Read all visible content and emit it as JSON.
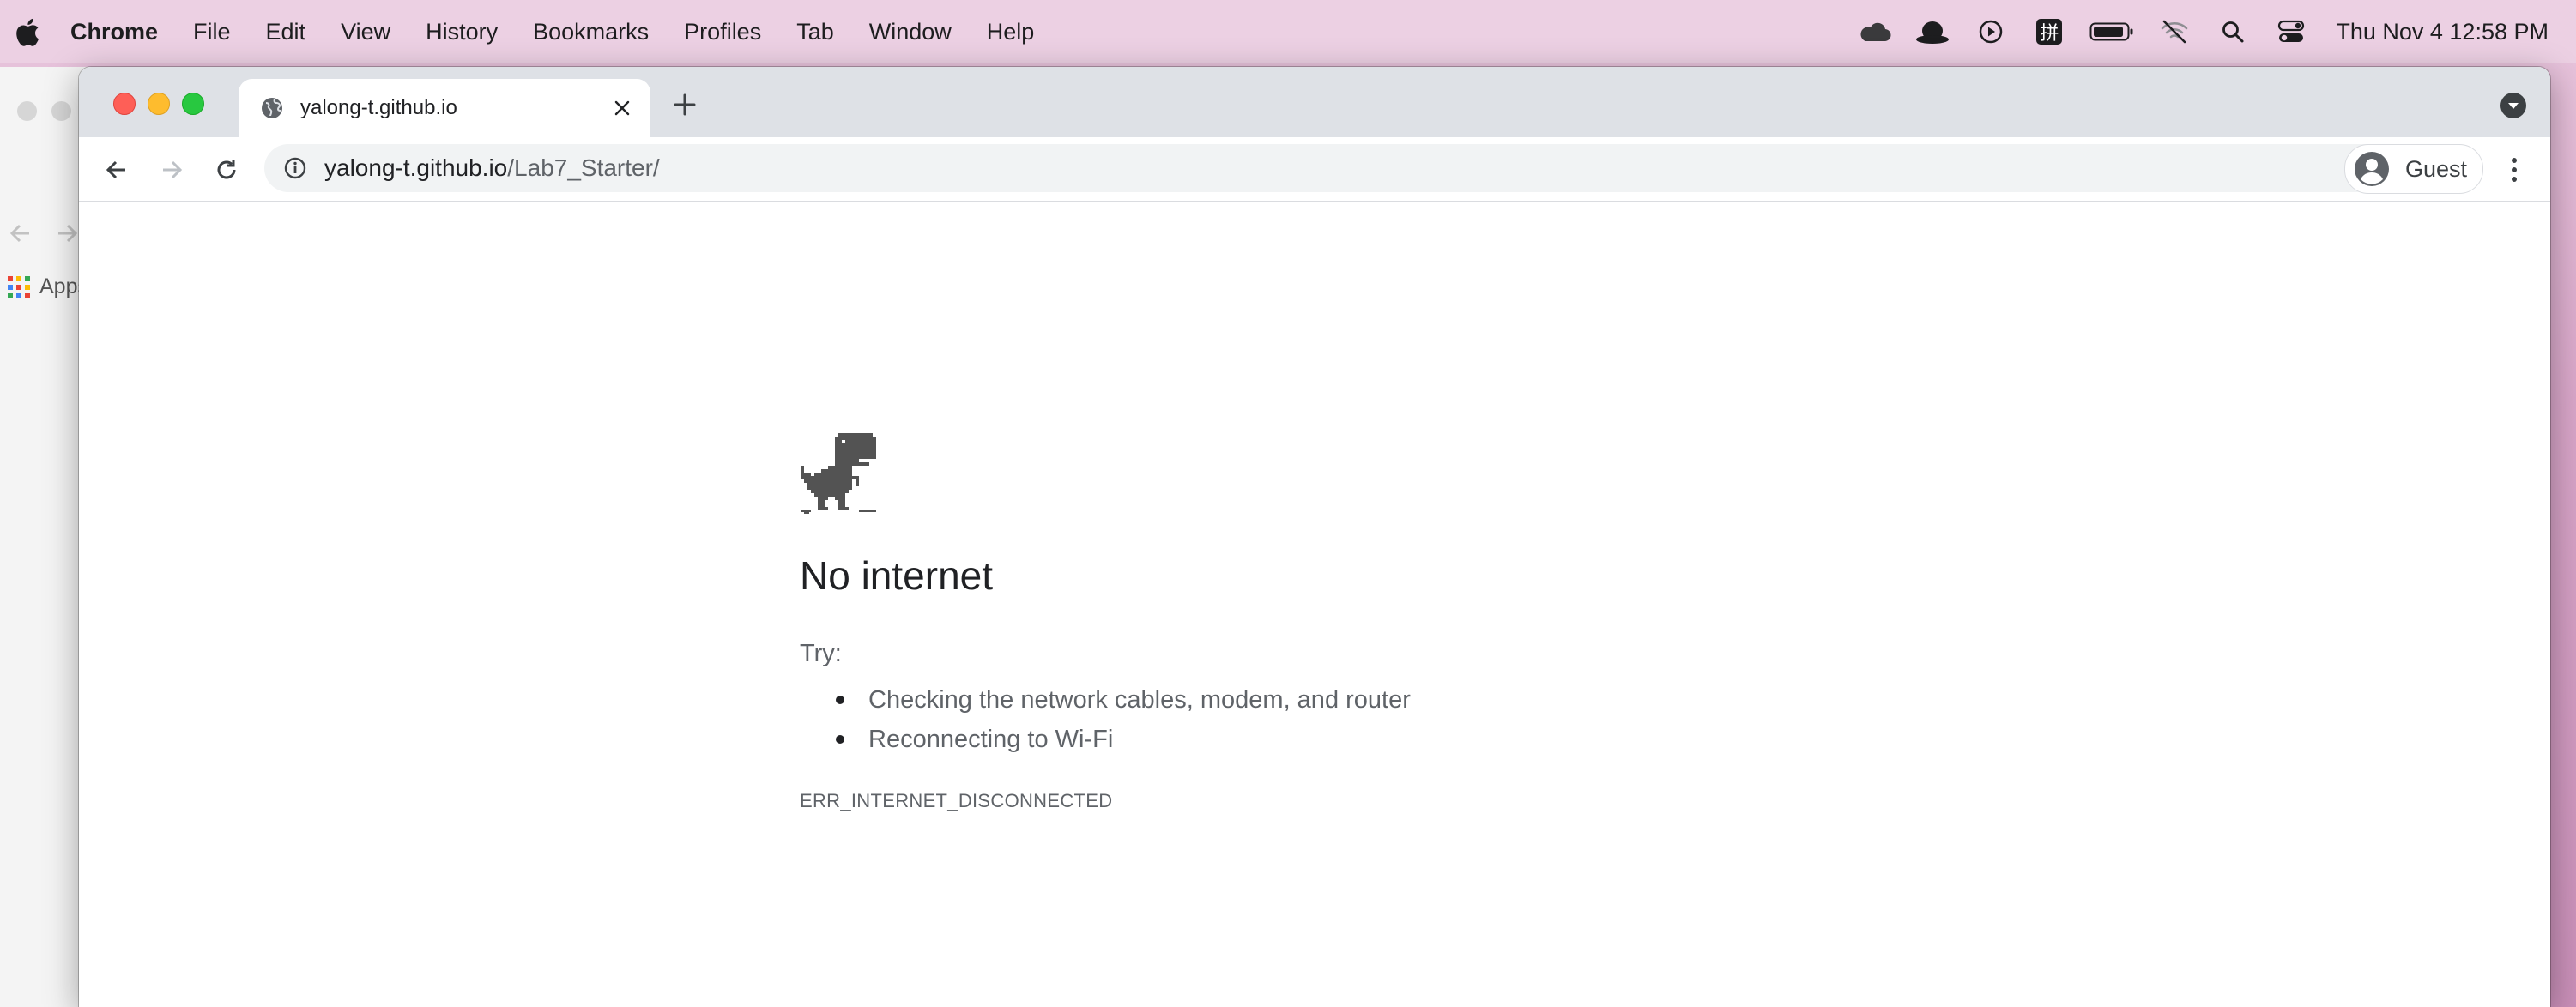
{
  "menubar": {
    "app_name": "Chrome",
    "items": [
      "File",
      "Edit",
      "View",
      "History",
      "Bookmarks",
      "Profiles",
      "Tab",
      "Window",
      "Help"
    ],
    "tray_icons": [
      "creative-cloud-icon",
      "alfred-hat-icon",
      "play-icon",
      "input-method-icon",
      "battery-icon",
      "wifi-off-icon",
      "spotlight-search-icon",
      "control-center-icon"
    ],
    "input_method_glyph": "拼",
    "clock": "Thu Nov 4  12:58 PM"
  },
  "background_window": {
    "apps_label": "Apps"
  },
  "tab": {
    "title": "yalong-t.github.io"
  },
  "omnibox": {
    "host": "yalong-t.github.io",
    "path": "/Lab7_Starter/"
  },
  "profile": {
    "name": "Guest"
  },
  "error_page": {
    "heading": "No internet",
    "try_label": "Try:",
    "suggestions": [
      "Checking the network cables, modem, and router",
      "Reconnecting to Wi-Fi"
    ],
    "error_code": "ERR_INTERNET_DISCONNECTED"
  },
  "colors": {
    "tab_strip": "#dee1e6",
    "omnibox_bg": "#f1f3f4",
    "close_red": "#fe5f57",
    "minimize_yellow": "#febc2e",
    "zoom_green": "#28c840"
  }
}
